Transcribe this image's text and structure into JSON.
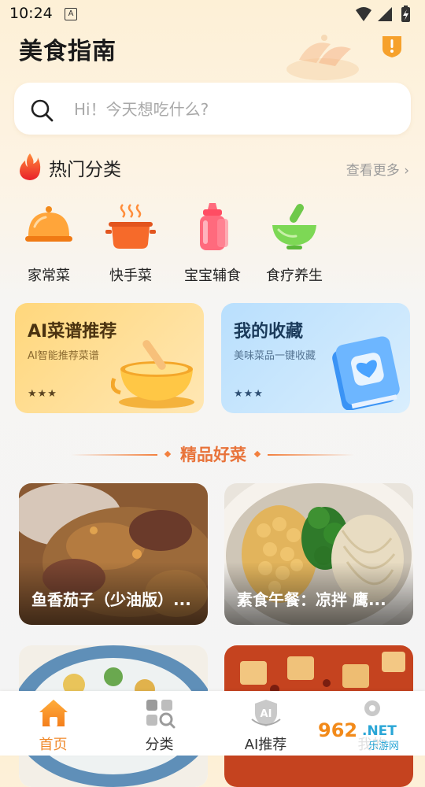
{
  "status_bar": {
    "time": "10:24",
    "icons": [
      "a-notification-icon",
      "wifi-icon",
      "signal-icon",
      "battery-charging-icon"
    ]
  },
  "header": {
    "title": "美食指南",
    "badge_icon": "shield-alert-icon"
  },
  "search": {
    "placeholder": "Hi！今天想吃什么?",
    "value": "",
    "icon": "search-icon"
  },
  "hot_categories": {
    "title": "热门分类",
    "more_label": "查看更多 ›",
    "items": [
      {
        "label": "家常菜",
        "icon": "cloche-icon"
      },
      {
        "label": "快手菜",
        "icon": "pot-icon"
      },
      {
        "label": "宝宝辅食",
        "icon": "baby-bottle-icon"
      },
      {
        "label": "食疗养生",
        "icon": "mortar-bowl-icon"
      }
    ]
  },
  "features": [
    {
      "title": "AI菜谱推荐",
      "subtitle": "AI智能推荐菜谱",
      "stars": "★★★",
      "illustration": "soup-bowl-icon"
    },
    {
      "title": "我的收藏",
      "subtitle": "美味菜品一键收藏",
      "stars": "★★★",
      "illustration": "heart-book-icon"
    }
  ],
  "featured_section": {
    "title": "精品好菜",
    "recipes": [
      {
        "title": "鱼香茄子（少油版）..."
      },
      {
        "title": "素食午餐：凉拌 鹰..."
      },
      {
        "title": ""
      },
      {
        "title": ""
      }
    ]
  },
  "bottom_nav": {
    "items": [
      {
        "label": "首页",
        "icon": "home-icon",
        "active": true
      },
      {
        "label": "分类",
        "icon": "category-grid-icon",
        "active": false
      },
      {
        "label": "AI推荐",
        "icon": "ai-shield-icon",
        "active": false
      },
      {
        "label": "我的",
        "icon": "profile-icon",
        "active": false
      }
    ]
  },
  "watermark": {
    "text": "962.NET",
    "subtext": "乐游网"
  },
  "colors": {
    "accent": "#f08a2c",
    "section_title": "#e8733a",
    "ai_card": "#ffd77c",
    "fav_card": "#b9dffd"
  }
}
